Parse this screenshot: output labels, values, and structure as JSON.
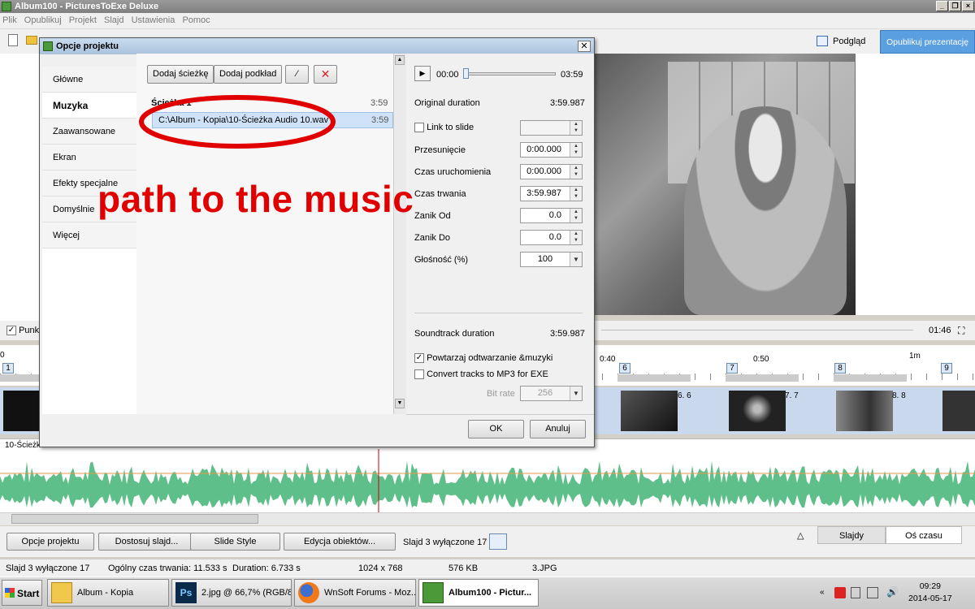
{
  "app": {
    "title": "Album100 - PicturesToExe Deluxe"
  },
  "menu": [
    "Plik",
    "Opublikuj",
    "Projekt",
    "Slajd",
    "Ustawienia",
    "Pomoc"
  ],
  "toolbar": {
    "preview_label": "Podgląd",
    "publish_label": "Opublikuj prezentację"
  },
  "timeline": {
    "punkt_label": "Punkt",
    "time_readout": "01:46",
    "ruler_labels": [
      "0",
      "0:40",
      "0:50",
      "1m"
    ],
    "slide_numbers": [
      "1",
      "6",
      "7",
      "8",
      "9"
    ],
    "thumb_labels": [
      "6. 6",
      "7. 7",
      "8. 8"
    ],
    "audio_label": "10-Ścieżk"
  },
  "bottom_buttons": {
    "project_options": "Opcje projektu",
    "customize_slide": "Dostosuj slajd...",
    "slide_style": "Slide Style",
    "edit_objects": "Edycja obiektów...",
    "slide_disabled": "Slajd 3 wyłączone 17",
    "tab_slides": "Slajdy",
    "tab_timeline": "Oś czasu"
  },
  "status": {
    "slide": "Slajd 3 wyłączone 17",
    "total_time": "Ogólny czas trwania: 11.533 s",
    "duration": "Duration: 6.733 s",
    "resolution": "1024 x 768",
    "size": "576 KB",
    "file": "3.JPG"
  },
  "taskbar": {
    "start": "Start",
    "tasks": [
      "Album - Kopia",
      "2.jpg @ 66,7% (RGB/8)",
      "WnSoft Forums - Moz...",
      "Album100 - Pictur..."
    ],
    "time": "09:29",
    "date": "2014-05-17"
  },
  "dialog": {
    "title": "Opcje projektu",
    "nav": [
      "Główne",
      "Muzyka",
      "Zaawansowane",
      "Ekran",
      "Efekty specjalne",
      "Domyślnie",
      "Więcej"
    ],
    "selected_nav": "Muzyka",
    "add_track": "Dodaj ścieżkę",
    "add_background": "Dodaj podkład",
    "track_header": "Ścieżka 1",
    "track_header_duration": "3:59",
    "track_file": "C:\\Album - Kopia\\10-Ścieżka Audio 10.wav",
    "track_file_duration": "3:59",
    "player": {
      "current": "00:00",
      "total": "03:59"
    },
    "original_duration_label": "Original duration",
    "original_duration_value": "3:59.987",
    "link_to_slide": "Link to slide",
    "fields": [
      {
        "label": "Przesunięcie",
        "value": "0:00.000"
      },
      {
        "label": "Czas uruchomienia",
        "value": "0:00.000"
      },
      {
        "label": "Czas trwania",
        "value": "3:59.987"
      },
      {
        "label": "Zanik Od",
        "value": "0.0"
      },
      {
        "label": "Zanik Do",
        "value": "0.0"
      }
    ],
    "volume_label": "Głośność (%)",
    "volume_value": "100",
    "soundtrack_duration_label": "Soundtrack duration",
    "soundtrack_duration_value": "3:59.987",
    "repeat_label": "Powtarzaj odtwarzanie &muzyki",
    "convert_label": "Convert tracks to MP3 for EXE",
    "bitrate_label": "Bit rate",
    "bitrate_value": "256",
    "ok": "OK",
    "cancel": "Anuluj"
  },
  "annotation": "path to the music",
  "colors": {
    "annotation": "#e00000",
    "selection": "#cfe2f8",
    "waveform": "#5fbf8a",
    "publish": "#5a9fe0"
  }
}
